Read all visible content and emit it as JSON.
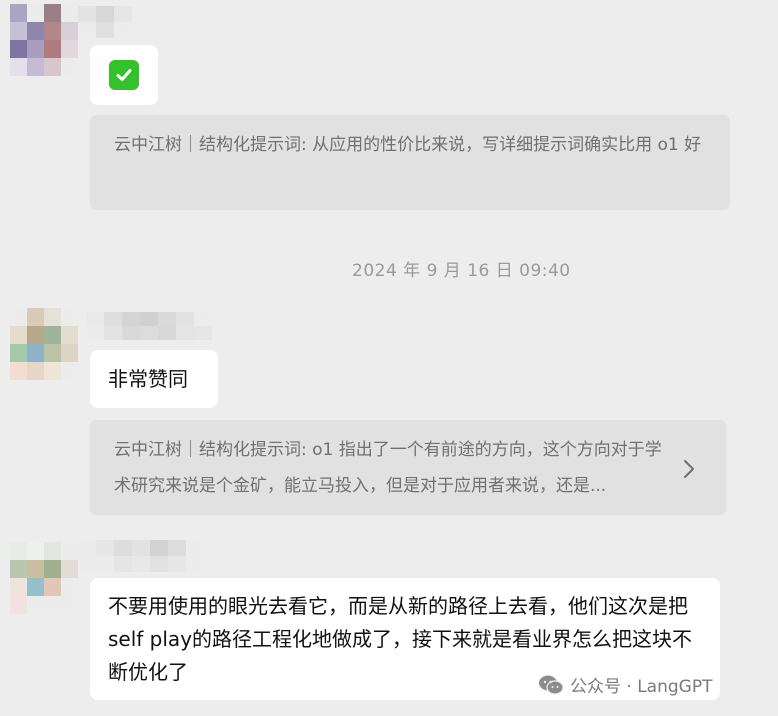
{
  "messages": [
    {
      "reaction_icon": "check-mark-icon",
      "quote": {
        "text": "云中江树｜结构化提示词: 从应用的性价比来说，写详细提示词确实比用 o1 好"
      }
    },
    {
      "timestamp": "2024 年 9 月 16 日 09:40"
    },
    {
      "text": "非常赞同",
      "quote": {
        "text": "云中江树｜结构化提示词: o1 指出了一个有前途的方向，这个方向对于学术研究来说是个金矿，能立马投入，但是对于应用者来说，还是..."
      }
    },
    {
      "text": "不要用使用的眼光去看它，而是从新的路径上去看，他们这次是把self play的路径工程化地做成了，接下来就是看业界怎么把这块不断优化了"
    }
  ],
  "watermark": {
    "icon": "wechat-icon",
    "text": "公众号 · LangGPT"
  },
  "colors": {
    "background": "#ededed",
    "bubble": "#ffffff",
    "quote_bg": "#e1e1e1",
    "check_green": "#35c12c"
  }
}
